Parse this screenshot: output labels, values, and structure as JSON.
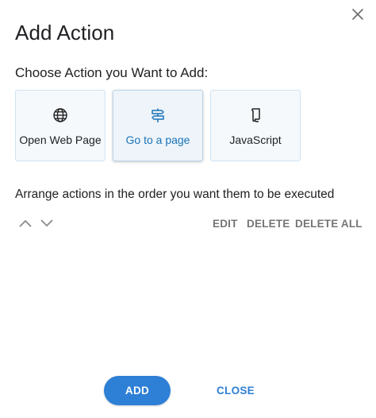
{
  "dialog": {
    "title": "Add Action",
    "close_icon": "close-icon"
  },
  "chooser": {
    "prompt": "Choose Action you Want to Add:",
    "options": [
      {
        "label": "Open Web Page",
        "icon": "globe-icon",
        "selected": false
      },
      {
        "label": "Go to a page",
        "icon": "signpost-icon",
        "selected": true
      },
      {
        "label": "JavaScript",
        "icon": "script-icon",
        "selected": false
      }
    ]
  },
  "actions_list": {
    "hint": "Arrange actions in the order you want them to be executed",
    "move_up_icon": "chevron-up-icon",
    "move_down_icon": "chevron-down-icon",
    "edit_label": "EDIT",
    "delete_label": "DELETE",
    "delete_all_label": "DELETE ALL"
  },
  "footer": {
    "add_label": "ADD",
    "close_label": "CLOSE"
  },
  "colors": {
    "accent": "#2e7fd6",
    "selected_label": "#1a73b8",
    "muted_action": "#757575",
    "card_border": "#cfe3f2"
  }
}
